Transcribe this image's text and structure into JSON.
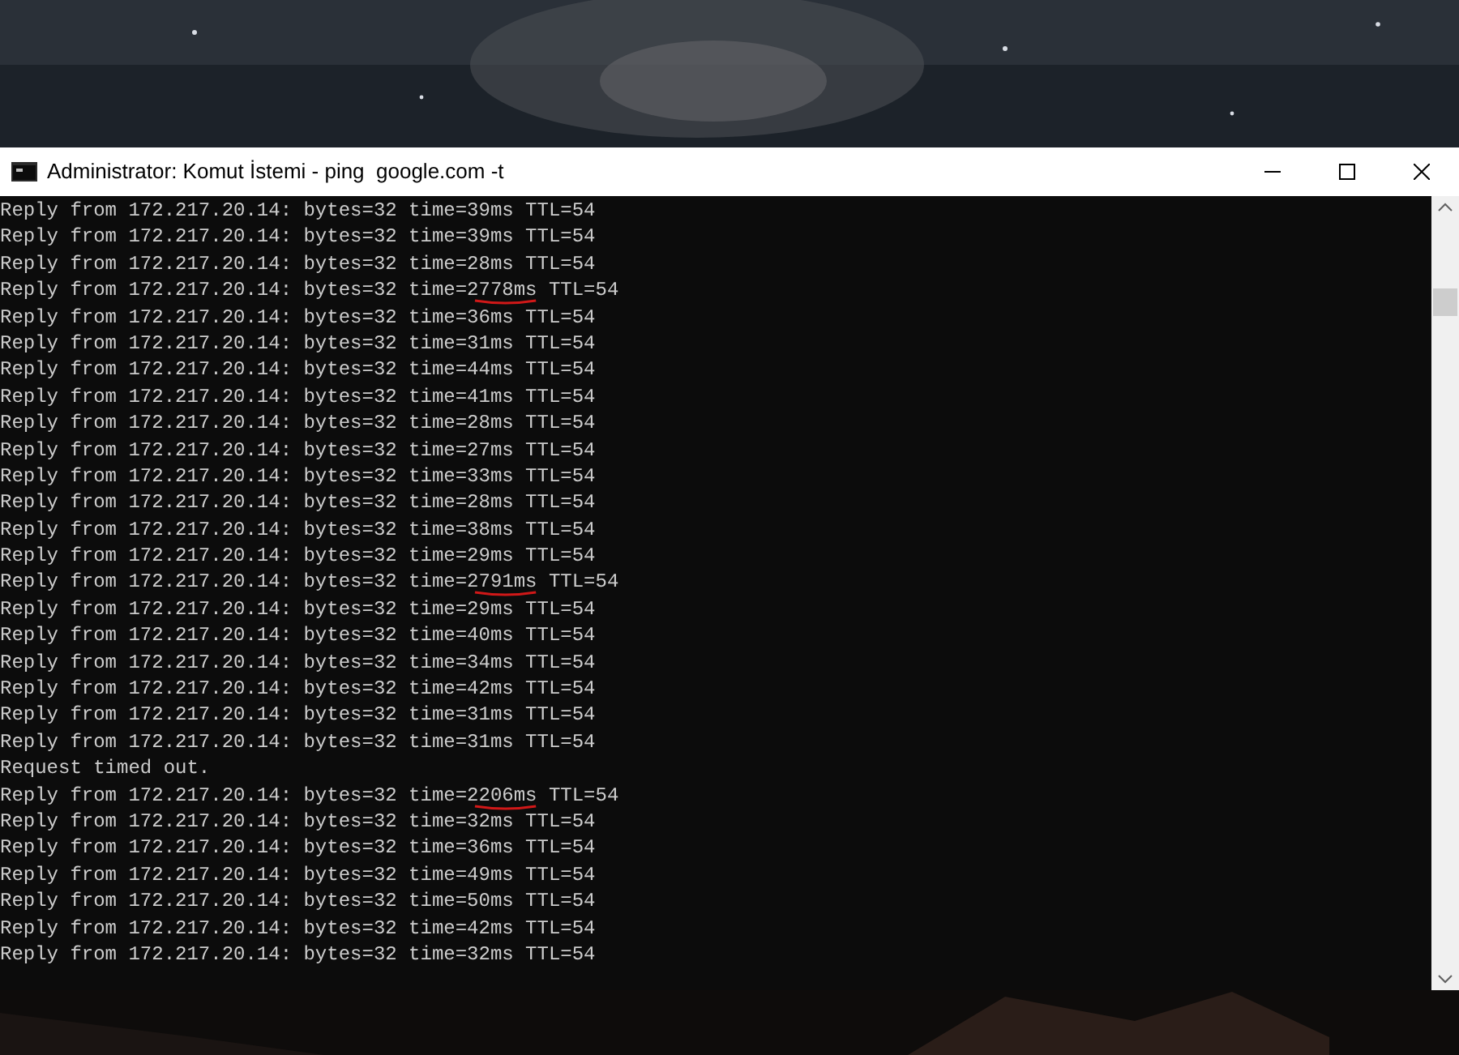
{
  "window": {
    "title": "Administrator: Komut İstemi - ping  google.com -t"
  },
  "console": {
    "lines": [
      {
        "text": "Reply from 172.217.20.14: bytes=32 time=39ms TTL=54",
        "marked": false
      },
      {
        "text": "Reply from 172.217.20.14: bytes=32 time=39ms TTL=54",
        "marked": false
      },
      {
        "text": "Reply from 172.217.20.14: bytes=32 time=28ms TTL=54",
        "marked": false
      },
      {
        "text": "Reply from 172.217.20.14: bytes=32 time=2778ms TTL=54",
        "marked": true
      },
      {
        "text": "Reply from 172.217.20.14: bytes=32 time=36ms TTL=54",
        "marked": false
      },
      {
        "text": "Reply from 172.217.20.14: bytes=32 time=31ms TTL=54",
        "marked": false
      },
      {
        "text": "Reply from 172.217.20.14: bytes=32 time=44ms TTL=54",
        "marked": false
      },
      {
        "text": "Reply from 172.217.20.14: bytes=32 time=41ms TTL=54",
        "marked": false
      },
      {
        "text": "Reply from 172.217.20.14: bytes=32 time=28ms TTL=54",
        "marked": false
      },
      {
        "text": "Reply from 172.217.20.14: bytes=32 time=27ms TTL=54",
        "marked": false
      },
      {
        "text": "Reply from 172.217.20.14: bytes=32 time=33ms TTL=54",
        "marked": false
      },
      {
        "text": "Reply from 172.217.20.14: bytes=32 time=28ms TTL=54",
        "marked": false
      },
      {
        "text": "Reply from 172.217.20.14: bytes=32 time=38ms TTL=54",
        "marked": false
      },
      {
        "text": "Reply from 172.217.20.14: bytes=32 time=29ms TTL=54",
        "marked": false
      },
      {
        "text": "Reply from 172.217.20.14: bytes=32 time=2791ms TTL=54",
        "marked": true
      },
      {
        "text": "Reply from 172.217.20.14: bytes=32 time=29ms TTL=54",
        "marked": false
      },
      {
        "text": "Reply from 172.217.20.14: bytes=32 time=40ms TTL=54",
        "marked": false
      },
      {
        "text": "Reply from 172.217.20.14: bytes=32 time=34ms TTL=54",
        "marked": false
      },
      {
        "text": "Reply from 172.217.20.14: bytes=32 time=42ms TTL=54",
        "marked": false
      },
      {
        "text": "Reply from 172.217.20.14: bytes=32 time=31ms TTL=54",
        "marked": false
      },
      {
        "text": "Reply from 172.217.20.14: bytes=32 time=31ms TTL=54",
        "marked": false
      },
      {
        "text": "Request timed out.",
        "marked": false
      },
      {
        "text": "Reply from 172.217.20.14: bytes=32 time=2206ms TTL=54",
        "marked": true
      },
      {
        "text": "Reply from 172.217.20.14: bytes=32 time=32ms TTL=54",
        "marked": false
      },
      {
        "text": "Reply from 172.217.20.14: bytes=32 time=36ms TTL=54",
        "marked": false
      },
      {
        "text": "Reply from 172.217.20.14: bytes=32 time=49ms TTL=54",
        "marked": false
      },
      {
        "text": "Reply from 172.217.20.14: bytes=32 time=50ms TTL=54",
        "marked": false
      },
      {
        "text": "Reply from 172.217.20.14: bytes=32 time=42ms TTL=54",
        "marked": false
      },
      {
        "text": "Reply from 172.217.20.14: bytes=32 time=32ms TTL=54",
        "marked": false
      }
    ]
  }
}
